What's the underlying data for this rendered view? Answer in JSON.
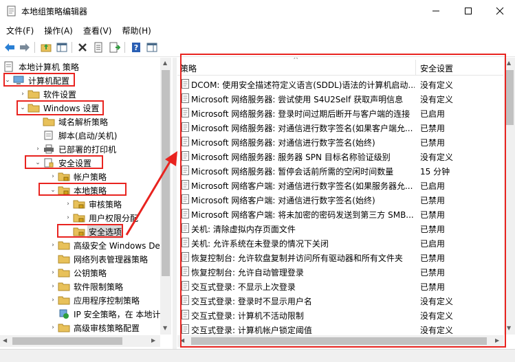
{
  "window": {
    "title": "本地组策略编辑器"
  },
  "menu": [
    "文件(F)",
    "操作(A)",
    "查看(V)",
    "帮助(H)"
  ],
  "tree": {
    "root": "本地计算机 策略",
    "computer_config": "计算机配置",
    "software_settings": "软件设置",
    "windows_settings": "Windows 设置",
    "dns": "域名解析策略",
    "scripts": "脚本(启动/关机)",
    "printers": "已部署的打印机",
    "security_settings": "安全设置",
    "account_policies": "帐户策略",
    "local_policies": "本地策略",
    "audit_policy": "审核策略",
    "user_rights": "用户权限分配",
    "security_options": "安全选项",
    "firewall": "高级安全 Windows Def",
    "network_list": "网络列表管理器策略",
    "public_key": "公钥策略",
    "software_restriction": "软件限制策略",
    "app_control": "应用程序控制策略",
    "ipsec": "IP 安全策略，在 本地计",
    "advanced_audit": "高级审核策略配置"
  },
  "list": {
    "col_policy": "策略",
    "col_setting": "安全设置",
    "rows": [
      {
        "policy": "DCOM: 使用安全描述符定义语言(SDDL)语法的计算机启动...",
        "setting": "没有定义"
      },
      {
        "policy": "Microsoft 网络服务器: 尝试使用 S4U2Self 获取声明信息",
        "setting": "没有定义"
      },
      {
        "policy": "Microsoft 网络服务器: 登录时间过期后断开与客户端的连接",
        "setting": "已启用"
      },
      {
        "policy": "Microsoft 网络服务器: 对通信进行数字签名(如果客户端允...",
        "setting": "已禁用"
      },
      {
        "policy": "Microsoft 网络服务器: 对通信进行数字签名(始终)",
        "setting": "已禁用"
      },
      {
        "policy": "Microsoft 网络服务器: 服务器 SPN 目标名称验证级别",
        "setting": "没有定义"
      },
      {
        "policy": "Microsoft 网络服务器: 暂停会话前所需的空闲时间数量",
        "setting": "15 分钟"
      },
      {
        "policy": "Microsoft 网络客户端: 对通信进行数字签名(如果服务器允...",
        "setting": "已启用"
      },
      {
        "policy": "Microsoft 网络客户端: 对通信进行数字签名(始终)",
        "setting": "已禁用"
      },
      {
        "policy": "Microsoft 网络客户端: 将未加密的密码发送到第三方 SMB...",
        "setting": "已禁用"
      },
      {
        "policy": "关机: 清除虚拟内存页面文件",
        "setting": "已禁用"
      },
      {
        "policy": "关机: 允许系统在未登录的情况下关闭",
        "setting": "已启用"
      },
      {
        "policy": "恢复控制台: 允许软盘复制并访问所有驱动器和所有文件夹",
        "setting": "已禁用"
      },
      {
        "policy": "恢复控制台: 允许自动管理登录",
        "setting": "已禁用"
      },
      {
        "policy": "交互式登录: 不显示上次登录",
        "setting": "已禁用"
      },
      {
        "policy": "交互式登录: 登录时不显示用户名",
        "setting": "没有定义"
      },
      {
        "policy": "交互式登录: 计算机不活动限制",
        "setting": "没有定义"
      },
      {
        "policy": "交互式登录: 计算机帐户锁定阈值",
        "setting": "没有定义"
      }
    ]
  },
  "colors": {
    "annotation": "#e8231f",
    "folder": "#e8c15a"
  }
}
